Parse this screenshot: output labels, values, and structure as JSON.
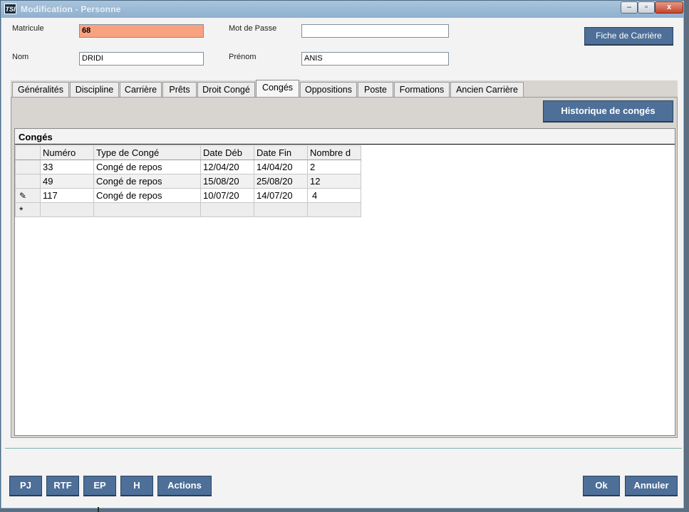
{
  "window": {
    "title": "Modification - Personne",
    "app_icon_text": "TSI",
    "minimize": "–",
    "maximize": "▫",
    "close": "x"
  },
  "form": {
    "matricule_label": "Matricule",
    "matricule_value": "68",
    "mot_de_passe_label": "Mot de Passe",
    "mot_de_passe_value": "",
    "nom_label": "Nom",
    "nom_value": "DRIDI",
    "prenom_label": "Prénom",
    "prenom_value": "ANIS",
    "fiche_carriere_button": "Fiche de Carrière"
  },
  "tabs": [
    {
      "label": "Généralités"
    },
    {
      "label": "Discipline"
    },
    {
      "label": "Carrière"
    },
    {
      "label": "Prêts"
    },
    {
      "label": "Droit Congé"
    },
    {
      "label": "Congés"
    },
    {
      "label": "Oppositions"
    },
    {
      "label": "Poste"
    },
    {
      "label": "Formations"
    },
    {
      "label": "Ancien Carrière"
    }
  ],
  "active_tab": "Congés",
  "panel": {
    "historique_button": "Historique de congés",
    "grid_title": "Congés",
    "columns": [
      "Numéro",
      "Type de Congé",
      "Date Déb",
      "Date Fin",
      "Nombre d"
    ],
    "rows": [
      {
        "selector": "",
        "numero": "33",
        "type": "Congé de repos",
        "date_deb": "12/04/20",
        "date_fin": "14/04/20",
        "nombre": "2"
      },
      {
        "selector": "",
        "numero": "49",
        "type": "Congé de repos",
        "date_deb": "15/08/20",
        "date_fin": "25/08/20",
        "nombre": "12"
      },
      {
        "selector": "✎",
        "numero": "117",
        "type": "Congé de repos",
        "date_deb": "10/07/20",
        "date_fin": "14/07/20",
        "nombre": "4"
      }
    ],
    "new_row_marker": "*"
  },
  "footer": {
    "pj": "PJ",
    "rtf": "RTF",
    "ep": "EP",
    "h": "H",
    "actions": "Actions",
    "ok": "Ok",
    "annuler": "Annuler"
  }
}
